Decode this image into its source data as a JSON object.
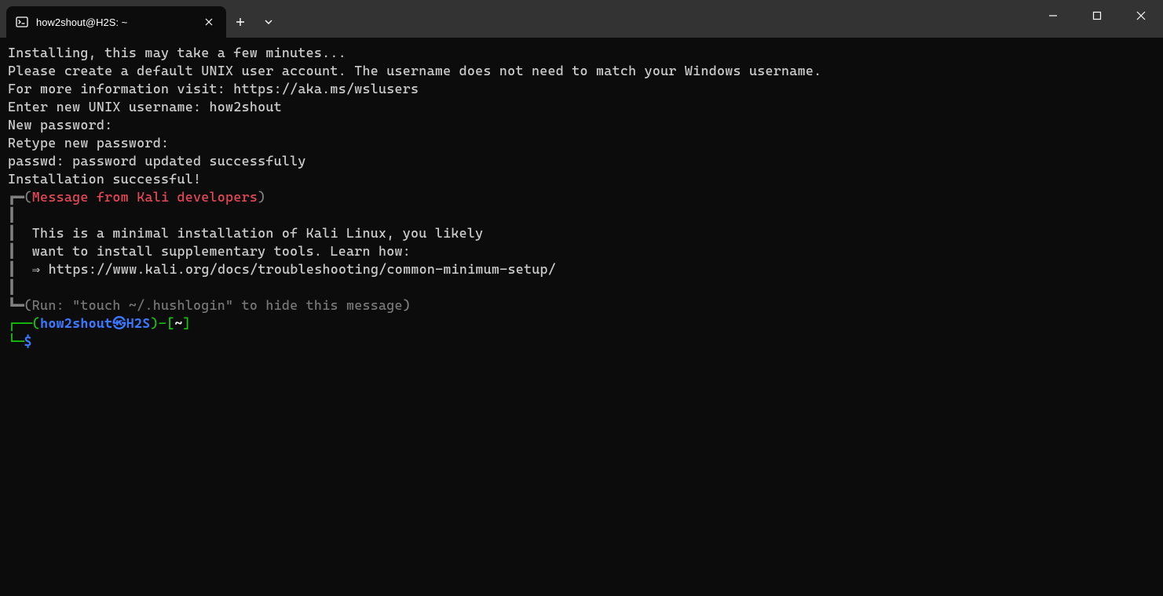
{
  "titlebar": {
    "tab_title": "how2shout@H2S: ~"
  },
  "terminal": {
    "l1": "Installing, this may take a few minutes...",
    "l2": "Please create a default UNIX user account. The username does not need to match your Windows username.",
    "l3": "For more information visit: https://aka.ms/wslusers",
    "l4a": "Enter new UNIX username: ",
    "l4b": "how2shout",
    "l5": "New password:",
    "l6": "Retype new password:",
    "l7": "passwd: password updated successfully",
    "l8": "Installation successful!",
    "box_corner_tl": "┏━",
    "box_open": "(",
    "box_msg_title": "Message from Kali developers",
    "box_close": ")",
    "box_side": "┃",
    "box_l1": "  This is a minimal installation of Kali Linux, you likely",
    "box_l2": "  want to install supplementary tools. Learn how:",
    "box_l3": "  ⇒ https://www.kali.org/docs/troubleshooting/common-minimum-setup/",
    "box_corner_bl": "┗━",
    "box_run": "Run: \"touch ~/.hushlogin\" to hide this message",
    "prompt_corner_top": "┌──",
    "prompt_paren_open": "(",
    "prompt_user": "how2shout",
    "prompt_at": "㉿",
    "prompt_host": "H2S",
    "prompt_paren_close": ")",
    "prompt_dash": "-",
    "prompt_bracket_open": "[",
    "prompt_path": "~",
    "prompt_bracket_close": "]",
    "prompt_corner_bot": "└─",
    "prompt_dollar": "$"
  }
}
